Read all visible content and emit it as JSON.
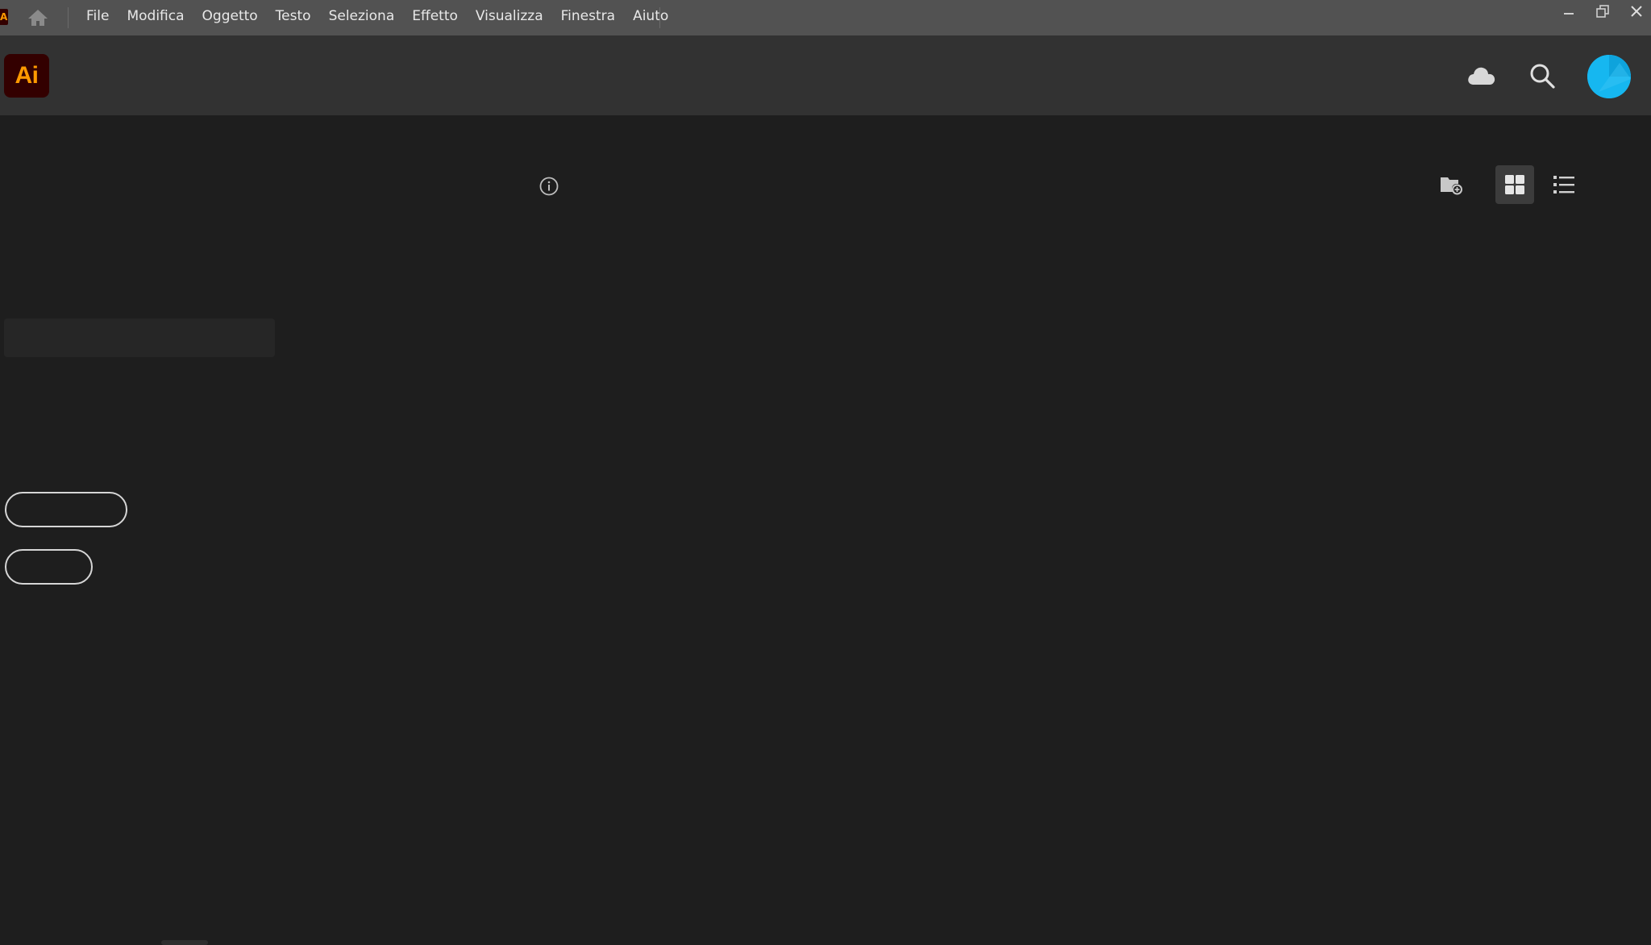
{
  "app": {
    "logo_text": "Ai",
    "brand_color": "#ff9a00",
    "logo_bg_color": "#330000",
    "accent_color": "#16b7f0"
  },
  "menubar": {
    "items": [
      "File",
      "Modifica",
      "Oggetto",
      "Testo",
      "Seleziona",
      "Effetto",
      "Visualizza",
      "Finestra",
      "Aiuto"
    ]
  },
  "window_controls": [
    "minimize-icon",
    "restore-icon",
    "close-icon"
  ],
  "header": {
    "icons": [
      "cloud-icon",
      "search-icon",
      "avatar"
    ]
  },
  "content": {
    "view_tools": [
      "new-folder-icon",
      "grid-view-icon",
      "list-view-icon"
    ],
    "active_view": "grid",
    "buttons": [
      {
        "label": ""
      },
      {
        "label": ""
      }
    ]
  }
}
